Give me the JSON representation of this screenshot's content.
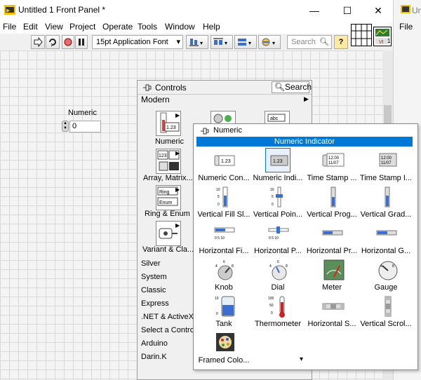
{
  "window": {
    "title": "Untitled 1 Front Panel *",
    "minimize": "—",
    "maximize": "☐",
    "close": "✕",
    "bg_title": "Un",
    "bg_menu": "File"
  },
  "menu": [
    "File",
    "Edit",
    "View",
    "Project",
    "Operate",
    "Tools",
    "Window",
    "Help"
  ],
  "toolbar": {
    "font": "15pt Application Font",
    "search_placeholder": "Search",
    "help": "?",
    "connector_number": "1"
  },
  "numeric_control": {
    "label": "Numeric",
    "value": "0"
  },
  "controls_palette": {
    "title": "Controls",
    "search": "Search",
    "section": "Modern",
    "tiles": [
      {
        "label": "Numeric",
        "icon": "numeric-icon"
      },
      {
        "label": "Array, Matrix...",
        "icon": "array-icon"
      },
      {
        "label": "Ring & Enum",
        "icon": "ring-enum-icon"
      },
      {
        "label": "Variant & Cla...",
        "icon": "variant-icon"
      }
    ],
    "categories": [
      "Silver",
      "System",
      "Classic",
      "Express",
      ".NET & ActiveX",
      "Select a Control...",
      "Arduino",
      "Darin.K"
    ]
  },
  "numeric_palette": {
    "title": "Numeric",
    "tooltip": "Numeric Indicator",
    "items": [
      {
        "label": "Numeric Con...",
        "icon": "numeric-control-icon"
      },
      {
        "label": "Numeric Indi...",
        "icon": "numeric-indicator-icon"
      },
      {
        "label": "Time Stamp ...",
        "icon": "time-stamp-control-icon"
      },
      {
        "label": "Time Stamp I...",
        "icon": "time-stamp-indicator-icon"
      },
      {
        "label": "Vertical Fill Sl...",
        "icon": "vertical-fill-slide-icon"
      },
      {
        "label": "Vertical Poin...",
        "icon": "vertical-pointer-slide-icon"
      },
      {
        "label": "Vertical Prog...",
        "icon": "vertical-progress-bar-icon"
      },
      {
        "label": "Vertical Grad...",
        "icon": "vertical-graduated-bar-icon"
      },
      {
        "label": "Horizontal Fi...",
        "icon": "horizontal-fill-slide-icon"
      },
      {
        "label": "Horizontal P...",
        "icon": "horizontal-pointer-slide-icon"
      },
      {
        "label": "Horizontal Pr...",
        "icon": "horizontal-progress-bar-icon"
      },
      {
        "label": "Horizontal G...",
        "icon": "horizontal-graduated-bar-icon"
      },
      {
        "label": "Knob",
        "icon": "knob-icon"
      },
      {
        "label": "Dial",
        "icon": "dial-icon"
      },
      {
        "label": "Meter",
        "icon": "meter-icon"
      },
      {
        "label": "Gauge",
        "icon": "gauge-icon"
      },
      {
        "label": "Tank",
        "icon": "tank-icon"
      },
      {
        "label": "Thermometer",
        "icon": "thermometer-icon"
      },
      {
        "label": "Horizontal S...",
        "icon": "horizontal-scrollbar-icon"
      },
      {
        "label": "Vertical Scrol...",
        "icon": "vertical-scrollbar-icon"
      },
      {
        "label": "Framed Colo...",
        "icon": "framed-color-box-icon"
      }
    ],
    "more_arrow": "▾"
  },
  "colors": {
    "accent": "#0078d7",
    "panel_bg": "#f4f4f4",
    "grid": "#d9d9d9"
  }
}
